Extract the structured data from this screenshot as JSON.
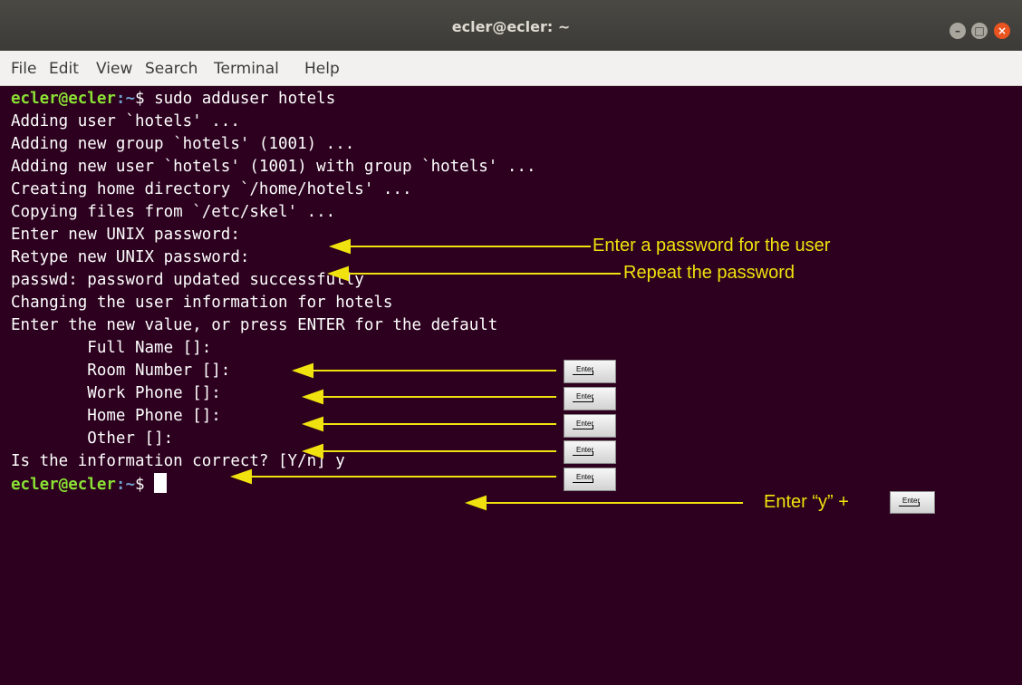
{
  "window": {
    "title": "ecler@ecler: ~"
  },
  "menu": [
    "File",
    "Edit",
    "View",
    "Search",
    "Terminal",
    "Help"
  ],
  "prompt": {
    "user": "ecler@ecler",
    "path": ":~",
    "symbol": "$ "
  },
  "terminal": {
    "command": "sudo adduser hotels",
    "lines": [
      "Adding user `hotels' ...",
      "Adding new group `hotels' (1001) ...",
      "Adding new user `hotels' (1001) with group `hotels' ...",
      "Creating home directory `/home/hotels' ...",
      "Copying files from `/etc/skel' ...",
      "Enter new UNIX password:",
      "Retype new UNIX password:",
      "passwd: password updated successfully",
      "Changing the user information for hotels",
      "Enter the new value, or press ENTER for the default",
      "        Full Name []:",
      "        Room Number []:",
      "        Work Phone []:",
      "        Home Phone []:",
      "        Other []:",
      "Is the information correct? [Y/n] y"
    ]
  },
  "annotations": {
    "password": "Enter a password for the user",
    "repeat": "Repeat the password",
    "confirm": "Enter “y” +"
  },
  "key_label": "Enter",
  "colors": {
    "background": "#2c001e",
    "prompt_user": "#8ae234",
    "prompt_path": "#729fcf",
    "annotation": "#f0e20e"
  }
}
